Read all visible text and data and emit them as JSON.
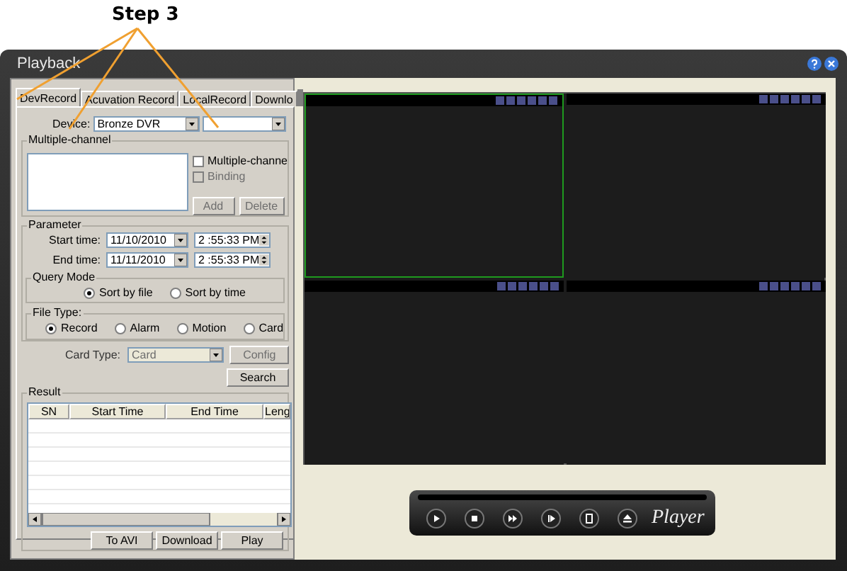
{
  "annotation": {
    "label": "Step 3"
  },
  "window": {
    "title": "Playback"
  },
  "tabs": [
    {
      "label": "DevRecord",
      "selected": true
    },
    {
      "label": "Acuvation Record",
      "selected": false
    },
    {
      "label": "LocalRecord",
      "selected": false
    },
    {
      "label": "Downlo",
      "selected": false
    }
  ],
  "device": {
    "label": "Device:",
    "value": "Bronze DVR"
  },
  "multiple_channel": {
    "title": "Multiple-channel",
    "options": [
      {
        "label": "Multiple-channe",
        "checked": false,
        "disabled": false
      },
      {
        "label": "Binding",
        "checked": false,
        "disabled": true
      }
    ],
    "buttons": [
      {
        "label": "Add",
        "disabled": true
      },
      {
        "label": "Delete",
        "disabled": true
      }
    ]
  },
  "parameter": {
    "title": "Parameter",
    "rows": [
      {
        "label": "Start time:",
        "date": "11/10/2010",
        "time": "2 :55:33 PM"
      },
      {
        "label": "End time:",
        "date": "11/11/2010",
        "time": "2 :55:33 PM"
      }
    ]
  },
  "query_mode": {
    "title": "Query Mode",
    "options": [
      {
        "label": "Sort by file",
        "selected": true
      },
      {
        "label": "Sort by time",
        "selected": false
      }
    ]
  },
  "file_type": {
    "title": "File Type:",
    "options": [
      {
        "label": "Record",
        "selected": true
      },
      {
        "label": "Alarm",
        "selected": false
      },
      {
        "label": "Motion",
        "selected": false
      },
      {
        "label": "Card",
        "selected": false
      }
    ]
  },
  "card_type": {
    "label": "Card Type:",
    "value": "Card",
    "disabled": true,
    "config": {
      "label": "Config",
      "disabled": true
    }
  },
  "search_button": {
    "label": "Search"
  },
  "result": {
    "title": "Result",
    "columns": [
      "SN",
      "Start Time",
      "End Time",
      "Leng"
    ]
  },
  "result_buttons": [
    "To AVI",
    "Download",
    "Play"
  ],
  "video_panes": [
    {
      "selected": true
    },
    {
      "selected": false
    },
    {
      "selected": false
    },
    {
      "selected": false
    }
  ],
  "player": {
    "logo": "Player"
  }
}
